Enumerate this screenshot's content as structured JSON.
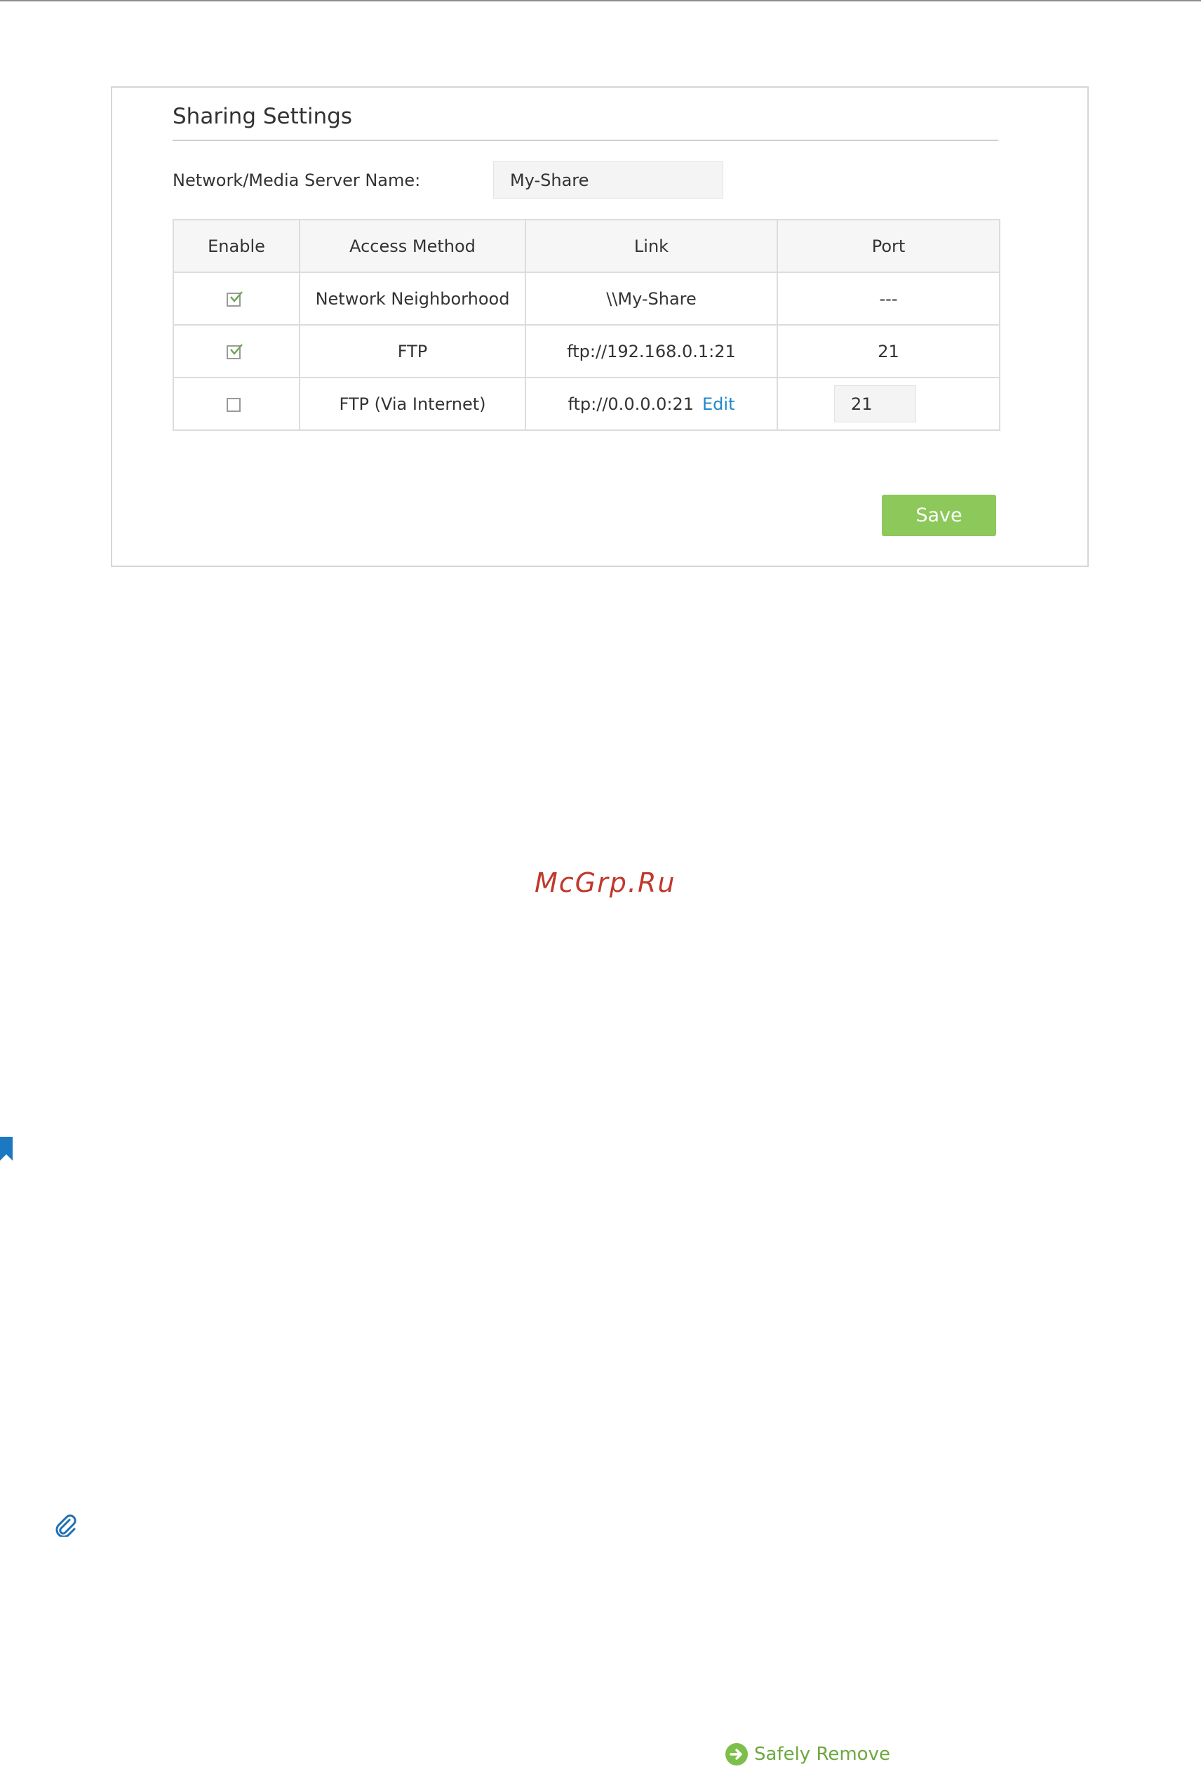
{
  "panel": {
    "title": "Sharing Settings",
    "server_name_label": "Network/Media Server Name:",
    "server_name_value": "My-Share",
    "table": {
      "headers": [
        "Enable",
        "Access Method",
        "Link",
        "Port"
      ],
      "rows": [
        {
          "enabled": true,
          "method": "Network Neighborhood",
          "link": "\\\\My-Share",
          "port": "---"
        },
        {
          "enabled": true,
          "method": "FTP",
          "link": "ftp://192.168.0.1:21",
          "port": "21"
        },
        {
          "enabled": false,
          "method": "FTP (Via Internet)",
          "link": "ftp://0.0.0.0:21",
          "edit_label": "Edit",
          "port": "21"
        }
      ]
    },
    "save_label": "Save"
  },
  "watermark": "McGrp.Ru",
  "safely_remove_label": "Safely Remove",
  "colors": {
    "accent_green": "#8cc85a",
    "link_blue": "#1f8ac9",
    "watermark_red": "#c0392b"
  }
}
